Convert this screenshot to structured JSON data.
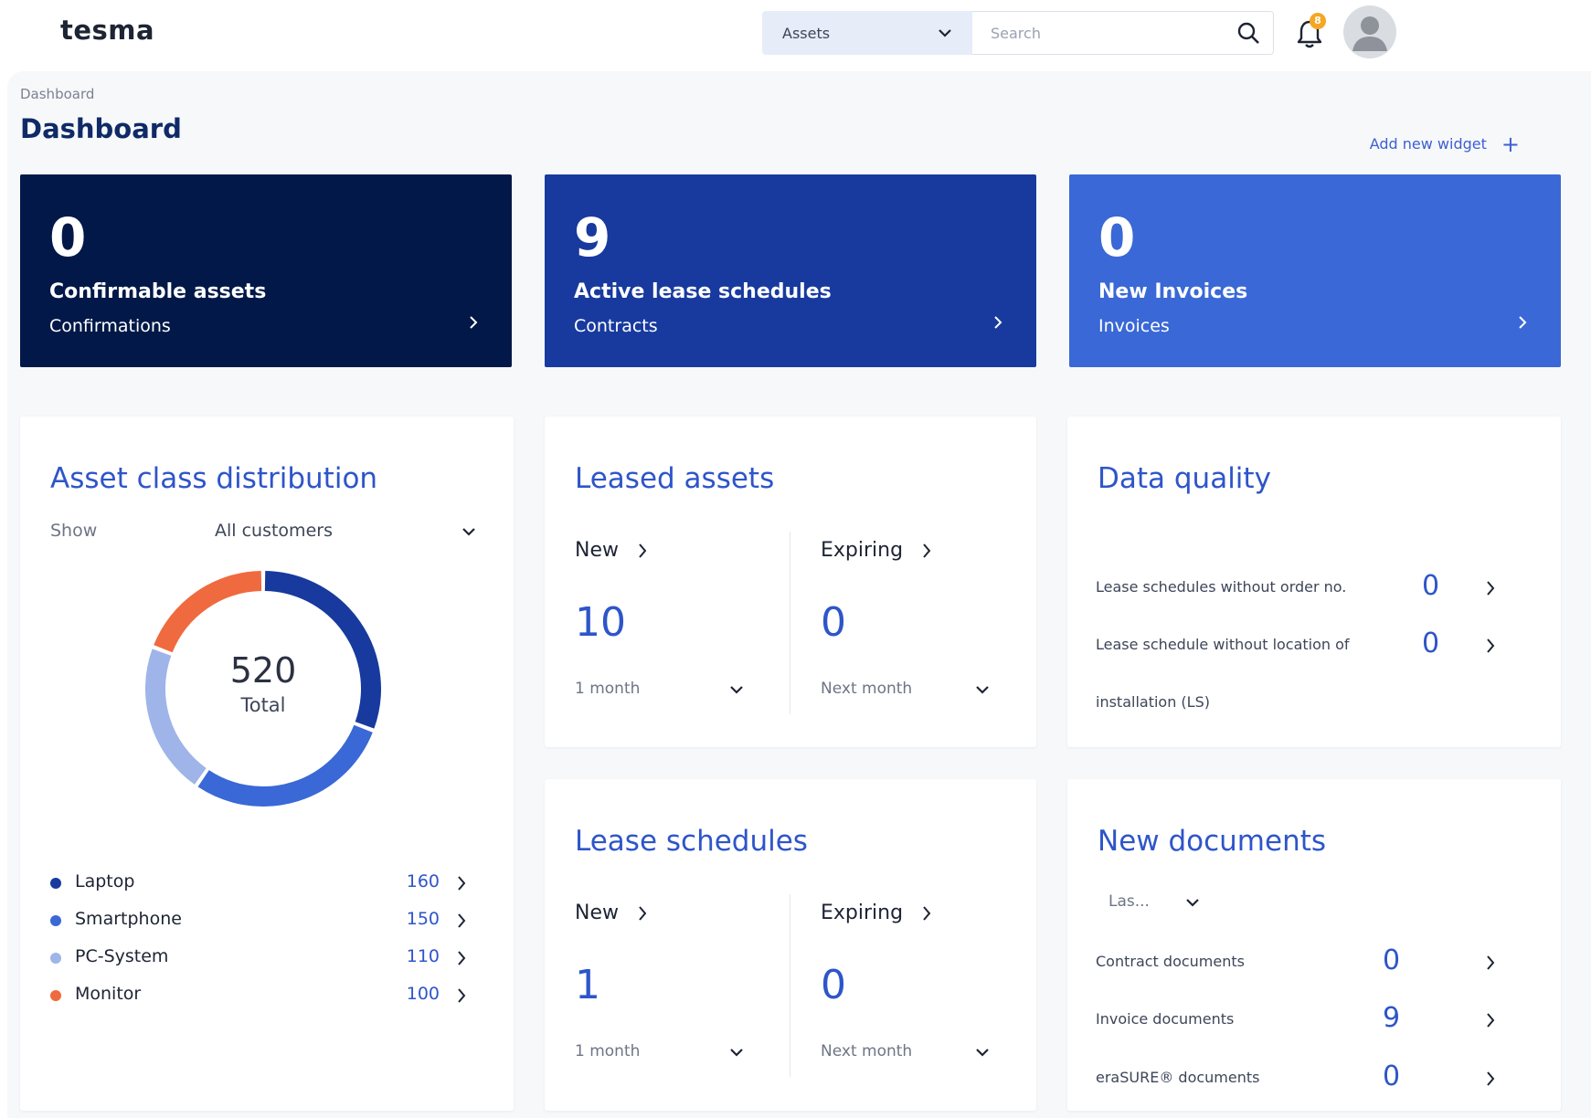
{
  "app": {
    "logo": "tesma"
  },
  "header": {
    "search_type": "Assets",
    "search_placeholder": "Search",
    "notification_count": "8"
  },
  "breadcrumb": "Dashboard",
  "page_title": "Dashboard",
  "add_widget_label": "Add new widget",
  "kpis": [
    {
      "value": "0",
      "title": "Confirmable assets",
      "sub": "Confirmations",
      "color": "#011848"
    },
    {
      "value": "9",
      "title": "Active lease schedules",
      "sub": "Contracts",
      "color": "#183a9e"
    },
    {
      "value": "0",
      "title": "New Invoices",
      "sub": "Invoices",
      "color": "#3a68d6"
    }
  ],
  "asset_distribution": {
    "title": "Asset class distribution",
    "show_label": "Show",
    "filter": "All customers",
    "total_value": "520",
    "total_label": "Total",
    "items": [
      {
        "label": "Laptop",
        "value": "160",
        "color": "#183a9e"
      },
      {
        "label": "Smartphone",
        "value": "150",
        "color": "#3a68d6"
      },
      {
        "label": "PC-System",
        "value": "110",
        "color": "#9fb4e8"
      },
      {
        "label": "Monitor",
        "value": "100",
        "color": "#f06a3f"
      }
    ]
  },
  "leased_assets": {
    "title": "Leased assets",
    "new_label": "New",
    "new_value": "10",
    "new_period": "1 month",
    "expiring_label": "Expiring",
    "expiring_value": "0",
    "expiring_period": "Next month"
  },
  "lease_schedules": {
    "title": "Lease schedules",
    "new_label": "New",
    "new_value": "1",
    "new_period": "1 month",
    "expiring_label": "Expiring",
    "expiring_value": "0",
    "expiring_period": "Next month"
  },
  "data_quality": {
    "title": "Data quality",
    "rows": [
      {
        "label": "Lease schedules without order no.",
        "value": "0"
      },
      {
        "label": "Lease schedule without location of",
        "label2": "installation (LS)",
        "value": "0"
      }
    ]
  },
  "new_documents": {
    "title": "New documents",
    "filter": "Las...",
    "rows": [
      {
        "label": "Contract documents",
        "value": "0"
      },
      {
        "label": "Invoice documents",
        "value": "9"
      },
      {
        "label": "eraSURE® documents",
        "value": "0"
      }
    ]
  }
}
